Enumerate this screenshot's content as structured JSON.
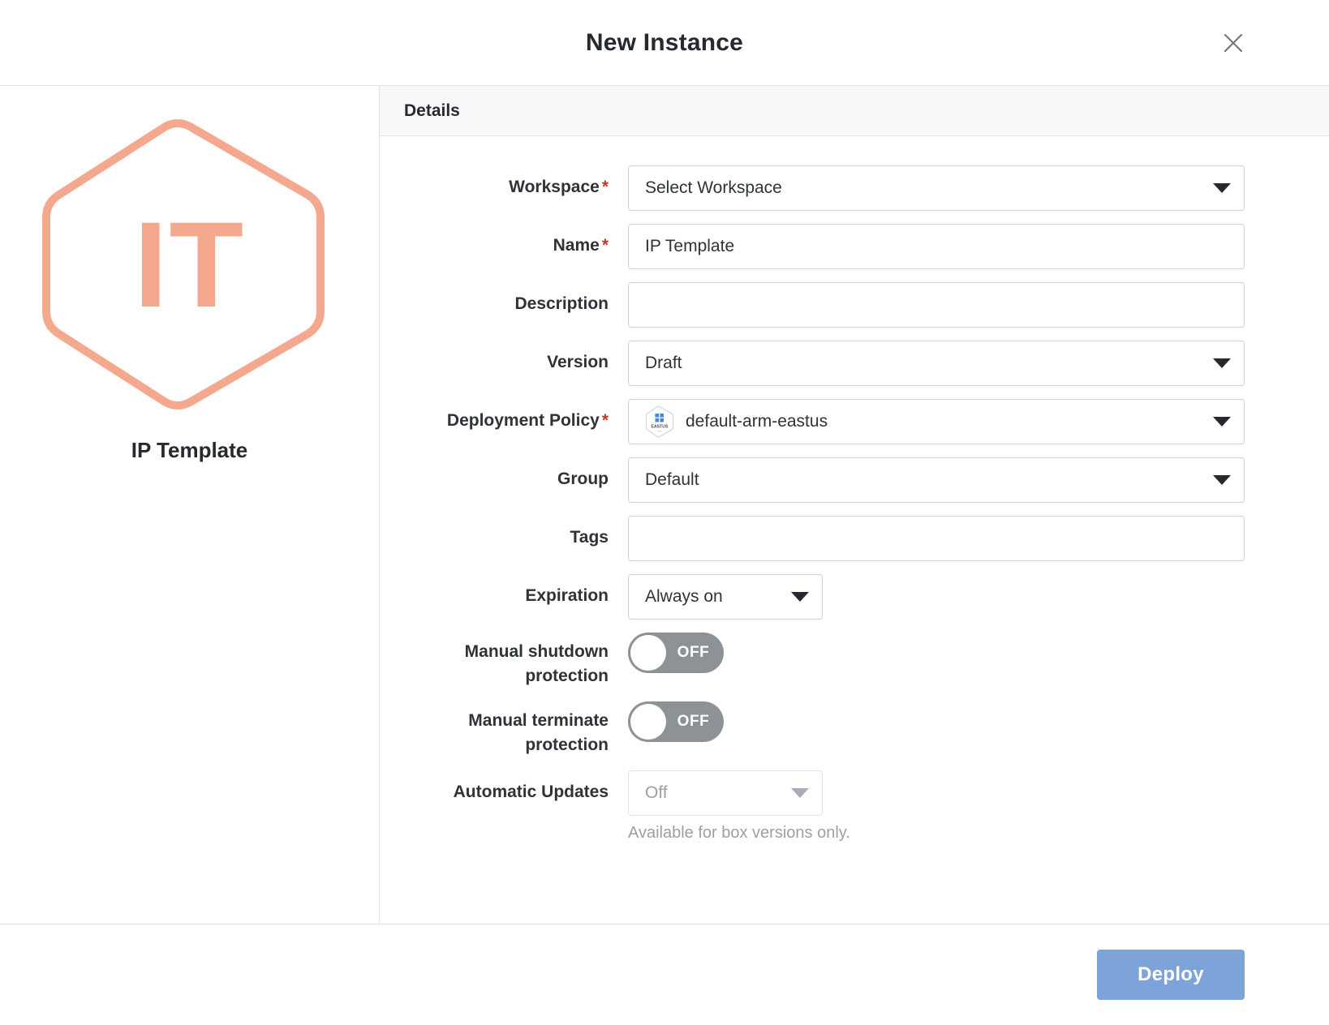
{
  "dialog": {
    "title": "New Instance",
    "close_icon": "close-icon"
  },
  "preview": {
    "initials": "IT",
    "label": "IP Template",
    "accent_color": "#f4a98e",
    "icon": "hexagon-template-icon"
  },
  "section": {
    "title": "Details"
  },
  "fields": {
    "workspace": {
      "label": "Workspace",
      "required": "*",
      "value": "Select Workspace",
      "type": "select"
    },
    "name": {
      "label": "Name",
      "required": "*",
      "value": "IP Template",
      "type": "text"
    },
    "description": {
      "label": "Description",
      "value": "",
      "placeholder": "",
      "type": "text"
    },
    "version": {
      "label": "Version",
      "value": "Draft",
      "type": "select"
    },
    "deployment_policy": {
      "label": "Deployment Policy",
      "required": "*",
      "value": "default-arm-eastus",
      "icon": "azure-eastus-region-icon",
      "icon_label": "EASTUS",
      "type": "select"
    },
    "group": {
      "label": "Group",
      "value": "Default",
      "type": "select"
    },
    "tags": {
      "label": "Tags",
      "value": "",
      "placeholder": "",
      "type": "text"
    },
    "expiration": {
      "label": "Expiration",
      "value": "Always on",
      "type": "select"
    },
    "manual_shutdown_protection": {
      "label": "Manual shutdown protection",
      "state": "OFF",
      "type": "toggle"
    },
    "manual_terminate_protection": {
      "label": "Manual terminate protection",
      "state": "OFF",
      "type": "toggle"
    },
    "automatic_updates": {
      "label": "Automatic Updates",
      "value": "Off",
      "disabled": true,
      "help": "Available for box versions only.",
      "type": "select"
    }
  },
  "footer": {
    "deploy_label": "Deploy",
    "deploy_color": "#7da3d9"
  }
}
